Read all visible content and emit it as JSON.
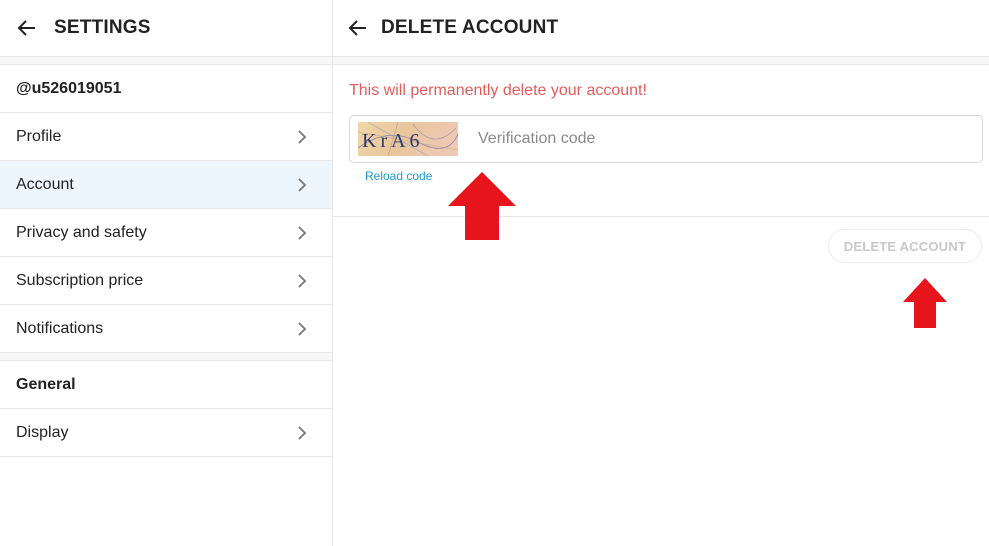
{
  "settings": {
    "title": "SETTINGS",
    "username": "@u526019051",
    "items": [
      {
        "label": "Profile"
      },
      {
        "label": "Account"
      },
      {
        "label": "Privacy and safety"
      },
      {
        "label": "Subscription price"
      },
      {
        "label": "Notifications"
      }
    ],
    "general_label": "General",
    "general_items": [
      {
        "label": "Display"
      }
    ]
  },
  "delete_account": {
    "title": "DELETE ACCOUNT",
    "warning": "This will permanently delete your account!",
    "captcha_text": "KrA6",
    "verification_placeholder": "Verification code",
    "verification_value": "",
    "reload_label": "Reload code",
    "button_label": "DELETE ACCOUNT"
  },
  "colors": {
    "warning": "#e45b5b",
    "link": "#1a9ad6",
    "active_row": "#eef6fd",
    "annotation_arrow": "#e8141b"
  }
}
